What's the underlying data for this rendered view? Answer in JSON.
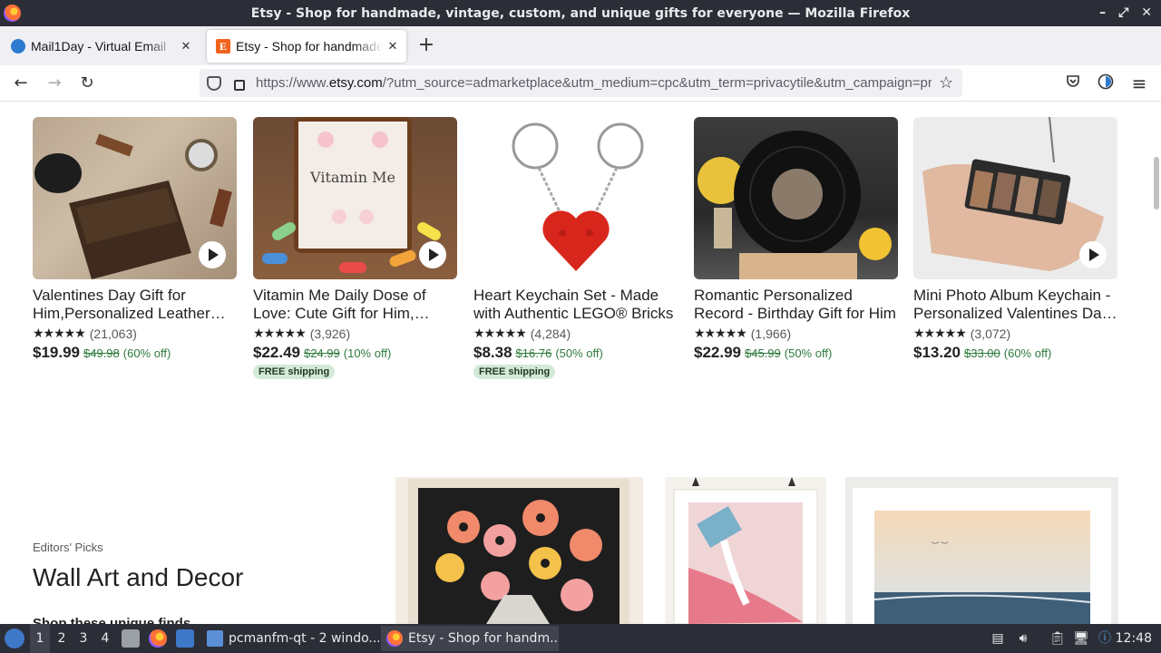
{
  "window": {
    "title": "Etsy - Shop for handmade, vintage, custom, and unique gifts for everyone — Mozilla Firefox",
    "min": "–",
    "max": "⤢",
    "close": "✕"
  },
  "tabs": [
    {
      "label": "Mail1Day - Virtual Email",
      "close": "✕"
    },
    {
      "label": "Etsy - Shop for handmade",
      "close": "✕"
    }
  ],
  "newtab": "+",
  "nav": {
    "back": "←",
    "forward": "→",
    "reload": "↻",
    "url_scheme": "https://www.",
    "url_domain": "etsy.com",
    "url_rest": "/?utm_source=admarketplace&utm_medium=cpc&utm_term=privacytile&utm_campaign=privacy",
    "bookmark": "☆",
    "menu": "≡"
  },
  "products": [
    {
      "title": "Valentines Day Gift for Him,Personalized Leather Wallet",
      "stars": "★★★★★",
      "reviews": "(21,063)",
      "price": "$19.99",
      "orig": "$49.98",
      "discount": "(60% off)",
      "badge": "",
      "video": true
    },
    {
      "title": "Vitamin Me Daily Dose of Love: Cute Gift for Him, Valentines",
      "stars": "★★★★★",
      "reviews": "(3,926)",
      "price": "$22.49",
      "orig": "$24.99",
      "discount": "(10% off)",
      "badge": "FREE shipping",
      "video": true
    },
    {
      "title": "Heart Keychain Set - Made with Authentic LEGO® Bricks",
      "stars": "★★★★★",
      "reviews": "(4,284)",
      "price": "$8.38",
      "orig": "$16.76",
      "discount": "(50% off)",
      "badge": "FREE shipping",
      "video": false
    },
    {
      "title": "Romantic Personalized Record - Birthday Gift for Him",
      "stars": "★★★★★",
      "reviews": "(1,966)",
      "price": "$22.99",
      "orig": "$45.99",
      "discount": "(50% off)",
      "badge": "",
      "video": false
    },
    {
      "title": "Mini Photo Album Keychain - Personalized Valentines Day Gift",
      "stars": "★★★★★",
      "reviews": "(3,072)",
      "price": "$13.20",
      "orig": "$33.00",
      "discount": "(60% off)",
      "badge": "",
      "video": true
    }
  ],
  "editors": {
    "kicker": "Editors' Picks",
    "heading": "Wall Art and Decor",
    "link": "Shop these unique finds →"
  },
  "taskbar": {
    "workspaces": [
      "1",
      "2",
      "3",
      "4"
    ],
    "tasks": [
      "pcmanfm-qt - 2 windo...",
      "Etsy - Shop for handm..."
    ],
    "clock": "12:48"
  }
}
